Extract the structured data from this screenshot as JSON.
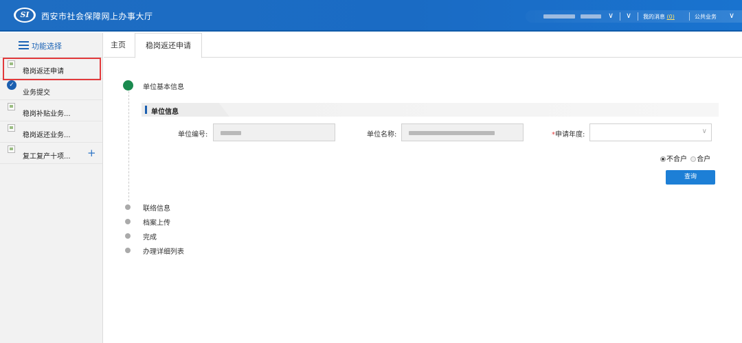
{
  "app": {
    "logo_text": "SI",
    "title": "西安市社会保障网上办事大厅"
  },
  "topbar": {
    "messages_label": "我的消息",
    "messages_count": "(0)",
    "public_business": "公共业务",
    "chevron": "∨"
  },
  "sidebar": {
    "header_label": "功能选择",
    "items": [
      {
        "label": "稳岗返还申请",
        "icon": "broken-image-icon"
      },
      {
        "label": "业务提交",
        "icon": "check-circle-icon"
      },
      {
        "label": "稳岗补贴业务...",
        "icon": "broken-image-icon"
      },
      {
        "label": "稳岗返还业务...",
        "icon": "broken-image-icon"
      },
      {
        "label": "复工复产十项...",
        "icon": "broken-image-icon"
      }
    ],
    "plus": "+"
  },
  "tabs": [
    {
      "label": "主页"
    },
    {
      "label": "稳岗返还申请",
      "active": true
    }
  ],
  "form": {
    "step_title": "单位基本信息",
    "section_title": "单位信息",
    "unit_code_label": "单位编号:",
    "unit_name_label": "单位名称:",
    "apply_year_label": "申请年度:",
    "required_mark": "*",
    "radio_option_1": "不合户",
    "radio_option_2": "合户",
    "query_button": "查询"
  },
  "steps": [
    {
      "label": "联络信息"
    },
    {
      "label": "档案上传"
    },
    {
      "label": "完成"
    },
    {
      "label": "办理详细列表"
    }
  ],
  "colors": {
    "topbar": "#1e6dc2",
    "accent": "#1b5fb0",
    "step_active": "#1a8a4f",
    "highlight_border": "#e2393b",
    "button": "#1d7fd6"
  }
}
